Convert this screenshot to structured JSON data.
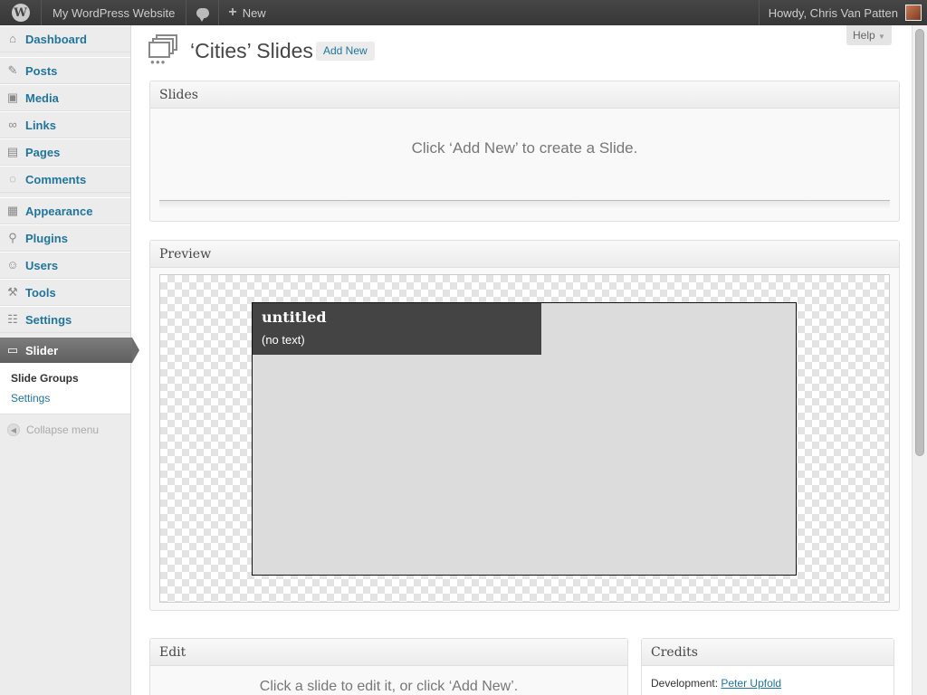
{
  "adminbar": {
    "site_name": "My WordPress Website",
    "new_label": "New",
    "greeting": "Howdy, Chris Van Patten"
  },
  "sidebar": {
    "items": [
      {
        "label": "Dashboard",
        "icon": "dashboard-icon"
      },
      {
        "label": "Posts",
        "icon": "posts-icon"
      },
      {
        "label": "Media",
        "icon": "media-icon"
      },
      {
        "label": "Links",
        "icon": "links-icon"
      },
      {
        "label": "Pages",
        "icon": "pages-icon"
      },
      {
        "label": "Comments",
        "icon": "comments-icon"
      },
      {
        "label": "Appearance",
        "icon": "appearance-icon"
      },
      {
        "label": "Plugins",
        "icon": "plugins-icon"
      },
      {
        "label": "Users",
        "icon": "users-icon"
      },
      {
        "label": "Tools",
        "icon": "tools-icon"
      },
      {
        "label": "Settings",
        "icon": "settings-icon"
      },
      {
        "label": "Slider",
        "icon": "slider-icon"
      }
    ],
    "submenu": [
      "Slide Groups",
      "Settings"
    ],
    "collapse_label": "Collapse menu"
  },
  "header": {
    "title": "‘Cities’ Slides",
    "add_new": "Add New",
    "help": "Help"
  },
  "slides": {
    "heading": "Slides",
    "empty_message": "Click ‘Add New’ to create a Slide."
  },
  "preview": {
    "heading": "Preview",
    "slide_title": "untitled",
    "slide_text": "(no text)"
  },
  "edit": {
    "heading": "Edit",
    "message": "Click a slide to edit it, or click ‘Add New’."
  },
  "credits": {
    "heading": "Credits",
    "development_label": "Development:",
    "development_name": "Peter Upfold"
  },
  "colors": {
    "link": "#21759b",
    "adminbar": "#464646",
    "current_menu": "#6e6e6e"
  }
}
